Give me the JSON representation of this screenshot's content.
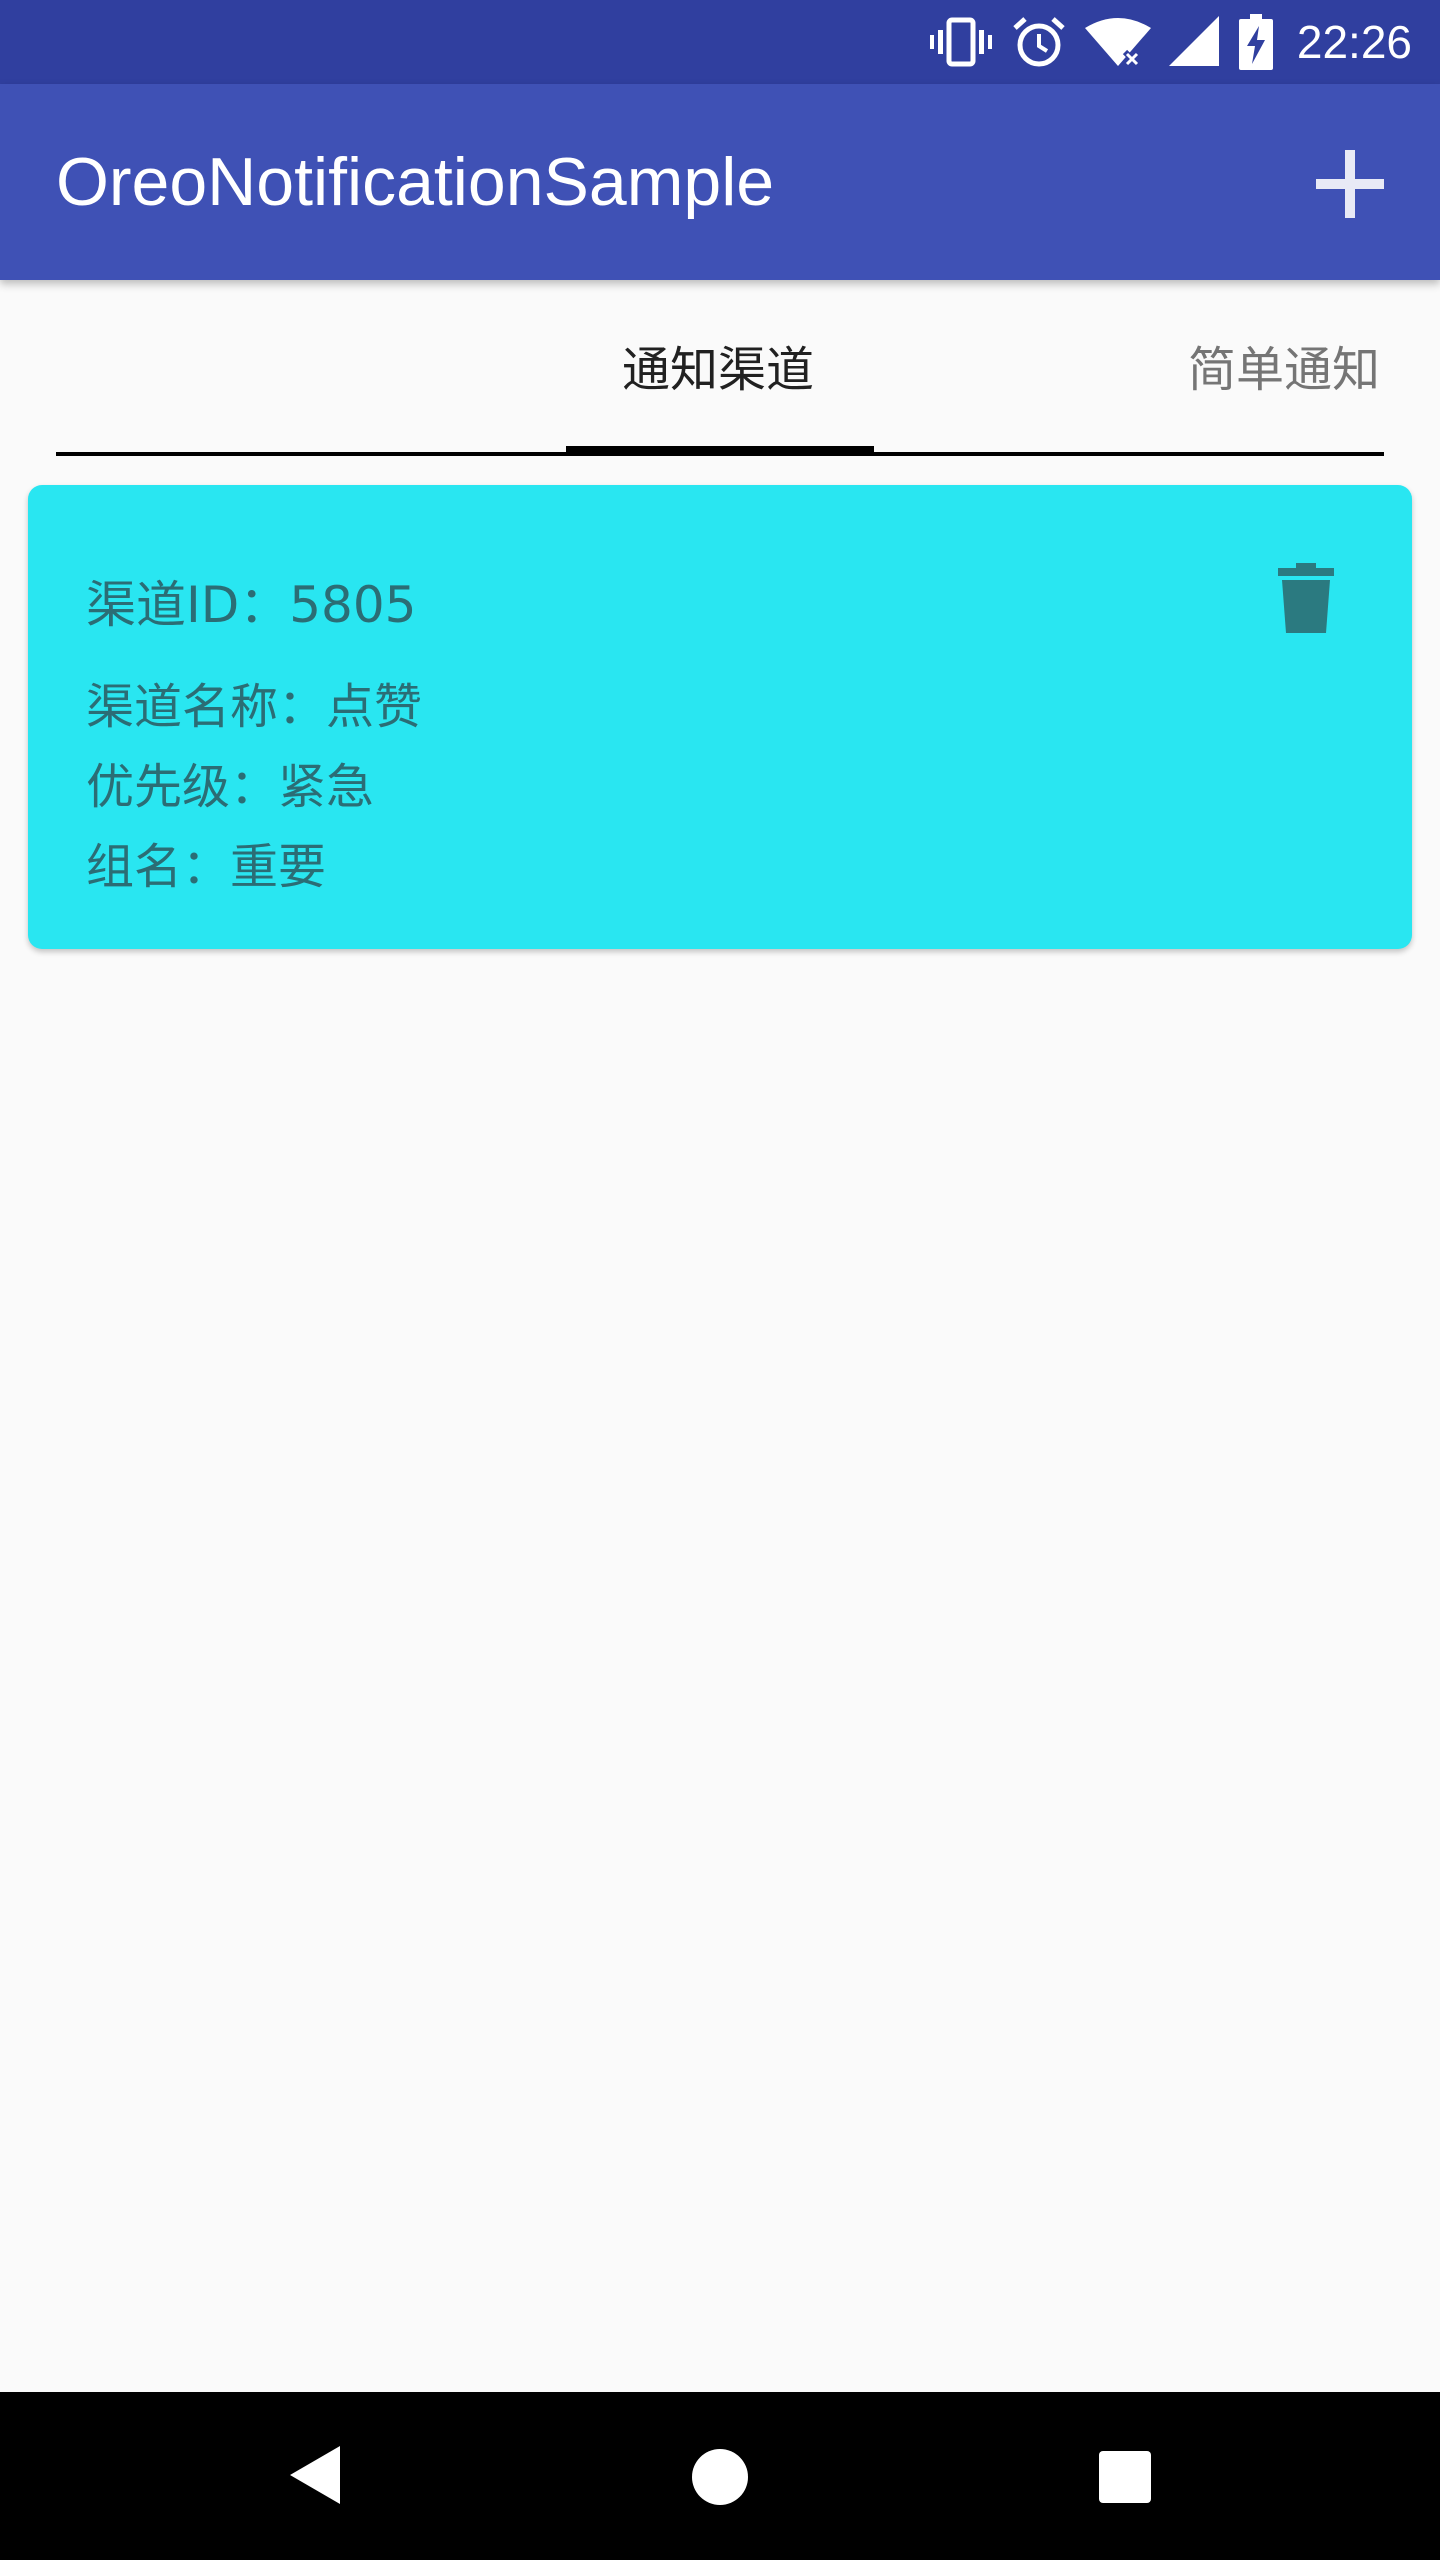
{
  "status_bar": {
    "time": "22:26",
    "icons": [
      "vibrate-icon",
      "alarm-icon",
      "wifi-icon",
      "signal-icon",
      "battery-charging-icon"
    ]
  },
  "app_bar": {
    "title": "OreoNotificationSample",
    "action_icon": "add-icon"
  },
  "tabs": [
    {
      "label": "通知渠道",
      "selected": true
    },
    {
      "label": "简单通知",
      "selected": false
    }
  ],
  "channel_card": {
    "id_label": "渠道ID：5805",
    "name_label": "渠道名称：点赞",
    "priority_label": "优先级：紧急",
    "group_label": "组名：重要",
    "delete_icon": "delete-icon"
  },
  "nav_bar": {
    "icons": [
      "back-icon",
      "home-icon",
      "recents-icon"
    ]
  },
  "colors": {
    "status_bar": "#303f9f",
    "app_bar": "#3f51b5",
    "card": "#29e6f1",
    "card_text": "#2b6d75",
    "background": "#fafafa"
  }
}
